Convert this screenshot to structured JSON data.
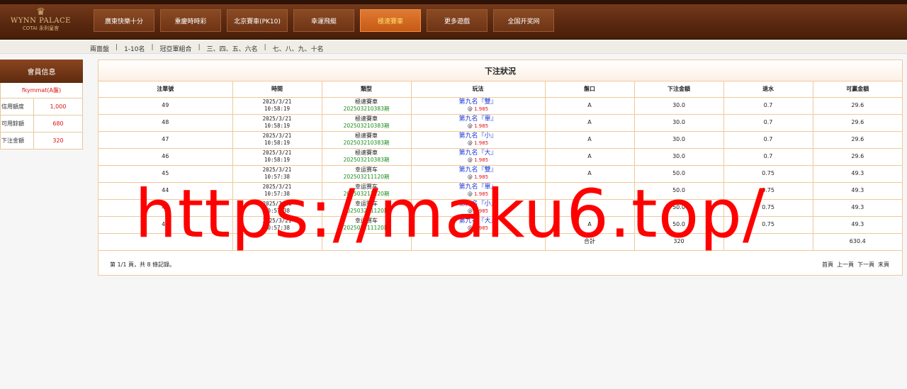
{
  "header": {
    "logo": {
      "brand": "WYNN PALACE",
      "sub1": "COTAI",
      "sub2": "永利皇宮"
    },
    "tabs": [
      "廣東快樂十分",
      "重慶時時彩",
      "北京賽車(PK10)",
      "幸運飛艇",
      "極速賽車",
      "更多遊戲",
      "全国开奖网"
    ],
    "active_tab": "極速賽車"
  },
  "subnav": {
    "items": [
      "兩面盤",
      "1-10名",
      "冠亞軍組合",
      "三、四、五、六名",
      "七、八、九、十名"
    ],
    "separator": "|"
  },
  "sidebar": {
    "title": "會員信息",
    "user": "fkymmat(A盤)",
    "rows": [
      {
        "label": "信用額度",
        "value": "1,000"
      },
      {
        "label": "可用餘額",
        "value": "680"
      },
      {
        "label": "下注金額",
        "value": "320"
      }
    ]
  },
  "panel": {
    "title": "下注狀況",
    "columns": [
      "注單號",
      "時間",
      "類型",
      "玩法",
      "盤口",
      "下注金額",
      "退水",
      "可贏金額"
    ],
    "rows": [
      {
        "id": "49",
        "date": "2025/3/21",
        "time": "10:58:19",
        "type": "極速賽車",
        "issue": "202503210383期",
        "play": "第九名『雙』",
        "odds_prefix": "@",
        "odds": "1.985",
        "pan": "A",
        "amount": "30.0",
        "rebate": "0.7",
        "win": "29.6"
      },
      {
        "id": "48",
        "date": "2025/3/21",
        "time": "10:58:19",
        "type": "極速賽車",
        "issue": "202503210383期",
        "play": "第九名『單』",
        "odds_prefix": "@",
        "odds": "1.985",
        "pan": "A",
        "amount": "30.0",
        "rebate": "0.7",
        "win": "29.6"
      },
      {
        "id": "47",
        "date": "2025/3/21",
        "time": "10:58:19",
        "type": "極速賽車",
        "issue": "202503210383期",
        "play": "第九名『小』",
        "odds_prefix": "@",
        "odds": "1.985",
        "pan": "A",
        "amount": "30.0",
        "rebate": "0.7",
        "win": "29.6"
      },
      {
        "id": "46",
        "date": "2025/3/21",
        "time": "10:58:19",
        "type": "極速賽車",
        "issue": "202503210383期",
        "play": "第九名『大』",
        "odds_prefix": "@",
        "odds": "1.985",
        "pan": "A",
        "amount": "30.0",
        "rebate": "0.7",
        "win": "29.6"
      },
      {
        "id": "45",
        "date": "2025/3/21",
        "time": "10:57:38",
        "type": "幸运赛车",
        "issue": "202503211120期",
        "play": "第九名『雙』",
        "odds_prefix": "@",
        "odds": "1.985",
        "pan": "A",
        "amount": "50.0",
        "rebate": "0.75",
        "win": "49.3"
      },
      {
        "id": "44",
        "date": "2025/3/21",
        "time": "10:57:38",
        "type": "幸运赛车",
        "issue": "202503211120期",
        "play": "第九名『單』",
        "odds_prefix": "@",
        "odds": "1.985",
        "pan": "A",
        "amount": "50.0",
        "rebate": "0.75",
        "win": "49.3"
      },
      {
        "id": "43",
        "date": "2025/3/21",
        "time": "10:57:38",
        "type": "幸运赛车",
        "issue": "202503211120期",
        "play": "第九名『小』",
        "odds_prefix": "@",
        "odds": "1.985",
        "pan": "A",
        "amount": "50.0",
        "rebate": "0.75",
        "win": "49.3"
      },
      {
        "id": "42",
        "date": "2025/3/21",
        "time": "10:57:38",
        "type": "幸运赛车",
        "issue": "202503211120期",
        "play": "第九名『大』",
        "odds_prefix": "@",
        "odds": "1.985",
        "pan": "A",
        "amount": "50.0",
        "rebate": "0.75",
        "win": "49.3"
      }
    ],
    "total": {
      "label": "合計",
      "amount": "320",
      "win": "630.4"
    },
    "pagination_info": "第 1/1 頁，共 8 條記錄。",
    "pager": [
      "首頁",
      "上一頁",
      "下一頁",
      "末頁"
    ]
  },
  "watermark": "https://maku6.top/"
}
